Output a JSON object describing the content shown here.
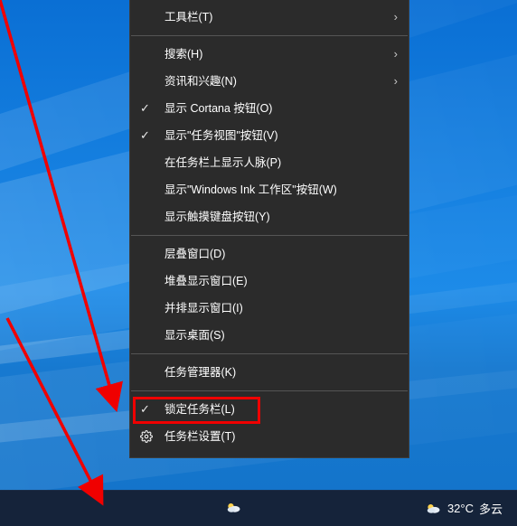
{
  "menu": {
    "toolbars": "工具栏(T)",
    "search": "搜索(H)",
    "news": "资讯和兴趣(N)",
    "show_cortana": "显示 Cortana 按钮(O)",
    "show_taskview": "显示\"任务视图\"按钮(V)",
    "show_people": "在任务栏上显示人脉(P)",
    "show_ink": "显示\"Windows Ink 工作区\"按钮(W)",
    "show_touchkb": "显示触摸键盘按钮(Y)",
    "cascade": "层叠窗口(D)",
    "stack": "堆叠显示窗口(E)",
    "sidebyside": "并排显示窗口(I)",
    "show_desktop": "显示桌面(S)",
    "task_manager": "任务管理器(K)",
    "lock_taskbar": "锁定任务栏(L)",
    "settings": "任务栏设置(T)"
  },
  "taskbar": {
    "temp": "32°C",
    "cond": "多云"
  }
}
